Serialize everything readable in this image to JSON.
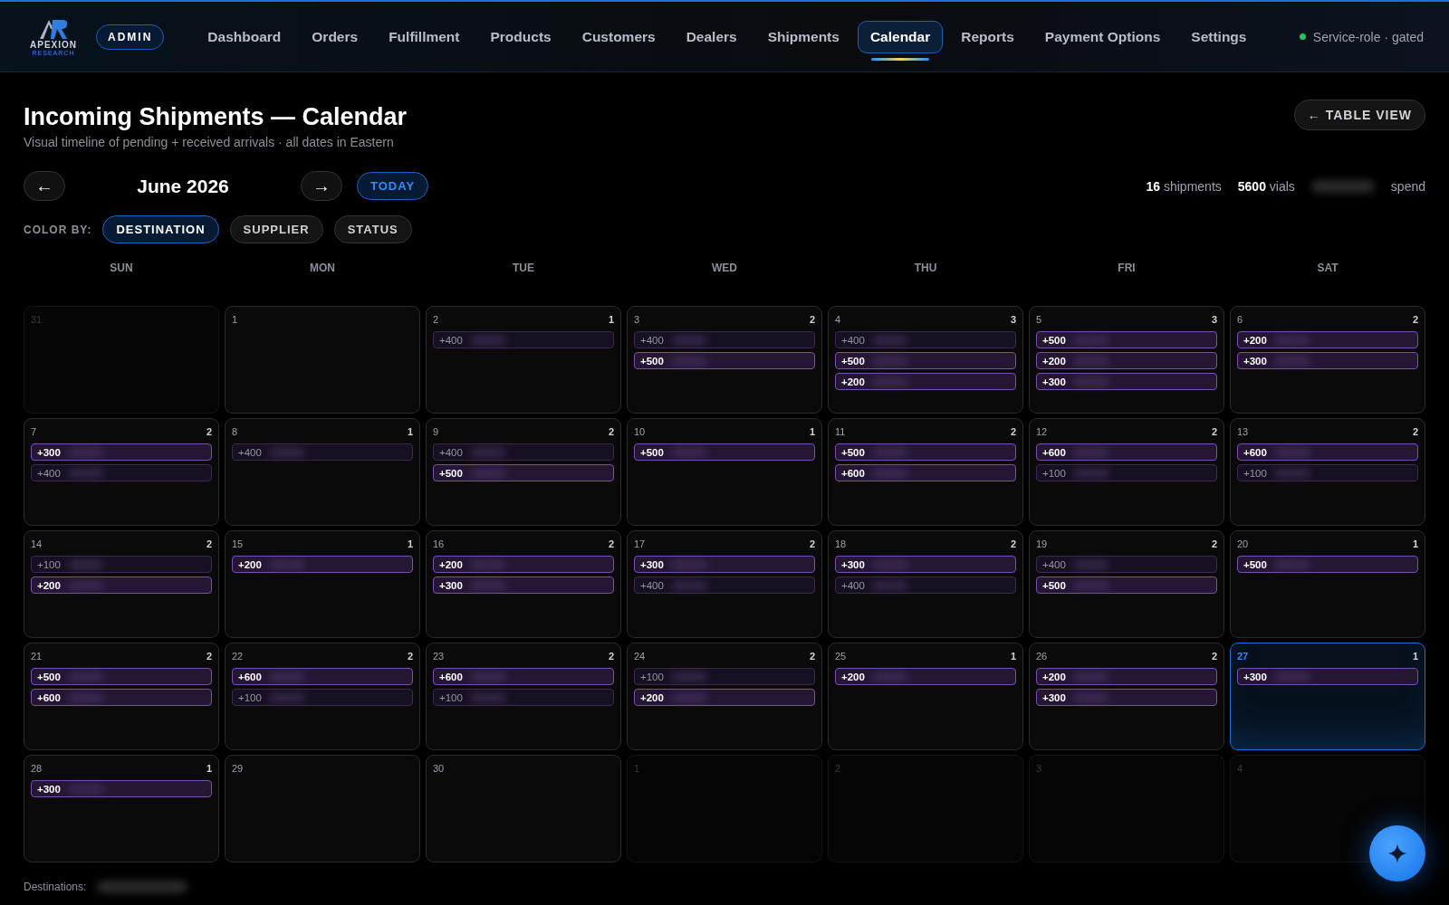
{
  "brand": {
    "name": "APEXION",
    "tagline": "RESEARCH",
    "badge": "ADMIN"
  },
  "nav": [
    {
      "label": "Dashboard",
      "selected": false
    },
    {
      "label": "Orders",
      "selected": false
    },
    {
      "label": "Fulfillment",
      "selected": false
    },
    {
      "label": "Products",
      "selected": false
    },
    {
      "label": "Customers",
      "selected": false
    },
    {
      "label": "Dealers",
      "selected": false
    },
    {
      "label": "Shipments",
      "selected": false
    },
    {
      "label": "Calendar",
      "selected": true
    },
    {
      "label": "Reports",
      "selected": false
    },
    {
      "label": "Payment Options",
      "selected": false
    },
    {
      "label": "Settings",
      "selected": false
    }
  ],
  "status": {
    "label": "Service-role · gated",
    "color": "#22c55e"
  },
  "title": "Incoming Shipments — Calendar",
  "subtitle": "Visual timeline of pending + received arrivals · all dates in Eastern",
  "table_view": "← TABLE VIEW",
  "month": {
    "prev": "←",
    "label": "June 2026",
    "next": "→",
    "today": "TODAY"
  },
  "stats": [
    "**16** shipments",
    "**5600** vials"
  ],
  "spend_label": "spend",
  "color_by": {
    "label": "COLOR BY:",
    "options": [
      {
        "label": "DESTINATION",
        "selected": true
      },
      {
        "label": "SUPPLIER",
        "selected": false
      },
      {
        "label": "STATUS",
        "selected": false
      }
    ]
  },
  "weekdays": [
    "SUN",
    "MON",
    "TUE",
    "WED",
    "THU",
    "FRI",
    "SAT"
  ],
  "days": [
    {
      "day": "31",
      "in_month": false,
      "today": false
    },
    {
      "day": "1",
      "in_month": true,
      "today": false
    },
    {
      "day": "2",
      "count": "1",
      "in_month": true,
      "today": false,
      "shipments": [
        {
          "qty": "+400",
          "received": false
        }
      ]
    },
    {
      "day": "3",
      "count": "2",
      "in_month": true,
      "today": false,
      "shipments": [
        {
          "qty": "+400",
          "received": false
        },
        {
          "qty": "+500",
          "received": true
        }
      ]
    },
    {
      "day": "4",
      "count": "3",
      "in_month": true,
      "today": false,
      "shipments": [
        {
          "qty": "+400",
          "received": false
        },
        {
          "qty": "+500",
          "received": true
        },
        {
          "qty": "+200",
          "received": true
        }
      ]
    },
    {
      "day": "5",
      "count": "3",
      "in_month": true,
      "today": false,
      "shipments": [
        {
          "qty": "+500",
          "received": true
        },
        {
          "qty": "+200",
          "received": true
        },
        {
          "qty": "+300",
          "received": true
        }
      ]
    },
    {
      "day": "6",
      "count": "2",
      "in_month": true,
      "today": false,
      "shipments": [
        {
          "qty": "+200",
          "received": true
        },
        {
          "qty": "+300",
          "received": true
        }
      ]
    },
    {
      "day": "7",
      "count": "2",
      "in_month": true,
      "today": false,
      "shipments": [
        {
          "qty": "+300",
          "received": true
        },
        {
          "qty": "+400",
          "received": false
        }
      ]
    },
    {
      "day": "8",
      "count": "1",
      "in_month": true,
      "today": false,
      "shipments": [
        {
          "qty": "+400",
          "received": false
        }
      ]
    },
    {
      "day": "9",
      "count": "2",
      "in_month": true,
      "today": false,
      "shipments": [
        {
          "qty": "+400",
          "received": false
        },
        {
          "qty": "+500",
          "received": true
        }
      ]
    },
    {
      "day": "10",
      "count": "1",
      "in_month": true,
      "today": false,
      "shipments": [
        {
          "qty": "+500",
          "received": true
        }
      ]
    },
    {
      "day": "11",
      "count": "2",
      "in_month": true,
      "today": false,
      "shipments": [
        {
          "qty": "+500",
          "received": true
        },
        {
          "qty": "+600",
          "received": true
        }
      ]
    },
    {
      "day": "12",
      "count": "2",
      "in_month": true,
      "today": false,
      "shipments": [
        {
          "qty": "+600",
          "received": true
        },
        {
          "qty": "+100",
          "received": false
        }
      ]
    },
    {
      "day": "13",
      "count": "2",
      "in_month": true,
      "today": false,
      "shipments": [
        {
          "qty": "+600",
          "received": true
        },
        {
          "qty": "+100",
          "received": false
        }
      ]
    },
    {
      "day": "14",
      "count": "2",
      "in_month": true,
      "today": false,
      "shipments": [
        {
          "qty": "+100",
          "received": false
        },
        {
          "qty": "+200",
          "received": true
        }
      ]
    },
    {
      "day": "15",
      "count": "1",
      "in_month": true,
      "today": false,
      "shipments": [
        {
          "qty": "+200",
          "received": true
        }
      ]
    },
    {
      "day": "16",
      "count": "2",
      "in_month": true,
      "today": false,
      "shipments": [
        {
          "qty": "+200",
          "received": true
        },
        {
          "qty": "+300",
          "received": true
        }
      ]
    },
    {
      "day": "17",
      "count": "2",
      "in_month": true,
      "today": false,
      "shipments": [
        {
          "qty": "+300",
          "received": true
        },
        {
          "qty": "+400",
          "received": false
        }
      ]
    },
    {
      "day": "18",
      "count": "2",
      "in_month": true,
      "today": false,
      "shipments": [
        {
          "qty": "+300",
          "received": true
        },
        {
          "qty": "+400",
          "received": false
        }
      ]
    },
    {
      "day": "19",
      "count": "2",
      "in_month": true,
      "today": false,
      "shipments": [
        {
          "qty": "+400",
          "received": false
        },
        {
          "qty": "+500",
          "received": true
        }
      ]
    },
    {
      "day": "20",
      "count": "1",
      "in_month": true,
      "today": false,
      "shipments": [
        {
          "qty": "+500",
          "received": true
        }
      ]
    },
    {
      "day": "21",
      "count": "2",
      "in_month": true,
      "today": false,
      "shipments": [
        {
          "qty": "+500",
          "received": true
        },
        {
          "qty": "+600",
          "received": true
        }
      ]
    },
    {
      "day": "22",
      "count": "2",
      "in_month": true,
      "today": false,
      "shipments": [
        {
          "qty": "+600",
          "received": true
        },
        {
          "qty": "+100",
          "received": false
        }
      ]
    },
    {
      "day": "23",
      "count": "2",
      "in_month": true,
      "today": false,
      "shipments": [
        {
          "qty": "+600",
          "received": true
        },
        {
          "qty": "+100",
          "received": false
        }
      ]
    },
    {
      "day": "24",
      "count": "2",
      "in_month": true,
      "today": false,
      "shipments": [
        {
          "qty": "+100",
          "received": false
        },
        {
          "qty": "+200",
          "received": true
        }
      ]
    },
    {
      "day": "25",
      "count": "1",
      "in_month": true,
      "today": false,
      "shipments": [
        {
          "qty": "+200",
          "received": true
        }
      ]
    },
    {
      "day": "26",
      "count": "2",
      "in_month": true,
      "today": false,
      "shipments": [
        {
          "qty": "+200",
          "received": true
        },
        {
          "qty": "+300",
          "received": true
        }
      ]
    },
    {
      "day": "27",
      "count": "1",
      "in_month": true,
      "today": true,
      "shipments": [
        {
          "qty": "+300",
          "received": true
        }
      ]
    },
    {
      "day": "28",
      "count": "1",
      "in_month": true,
      "today": false,
      "shipments": [
        {
          "qty": "+300",
          "received": true
        }
      ]
    },
    {
      "day": "29",
      "in_month": true,
      "today": false
    },
    {
      "day": "30",
      "in_month": true,
      "today": false
    },
    {
      "day": "1",
      "in_month": false,
      "today": false
    },
    {
      "day": "2",
      "in_month": false,
      "today": false
    },
    {
      "day": "3",
      "in_month": false,
      "today": false
    },
    {
      "day": "4",
      "in_month": false,
      "today": false
    }
  ],
  "legend_label": "Destinations:"
}
